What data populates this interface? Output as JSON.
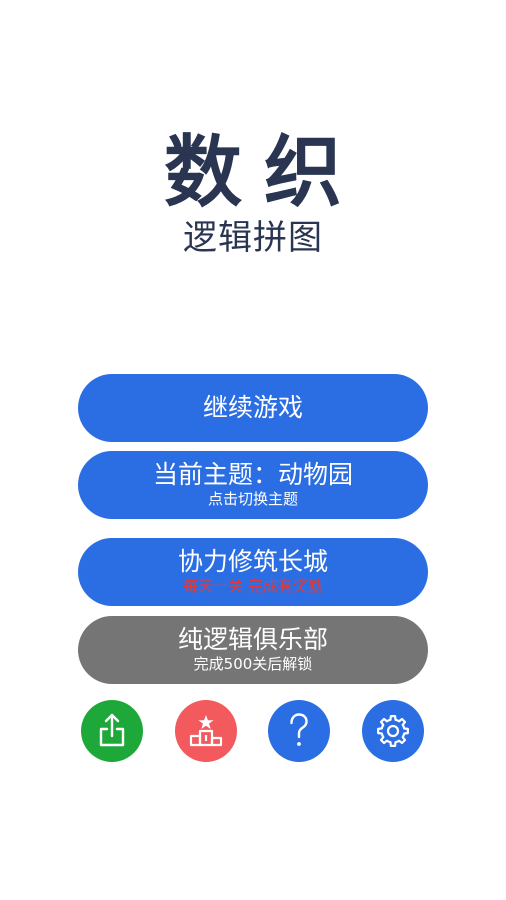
{
  "header": {
    "title": "数织",
    "subtitle": "逻辑拼图"
  },
  "menu": {
    "continue": {
      "label": "继续游戏"
    },
    "theme": {
      "label": "当前主题：动物园",
      "sub": "点击切换主题"
    },
    "great_wall": {
      "label": "协力修筑长城",
      "sub": "每天一关 完成有奖励"
    },
    "club": {
      "label": "纯逻辑俱乐部",
      "sub": "完成500关后解锁"
    }
  },
  "toolbar": {
    "share": {
      "icon": "share-icon",
      "color": "#1fa83a"
    },
    "leaderboard": {
      "icon": "podium-icon",
      "color": "#f25a5e"
    },
    "help": {
      "icon": "question-icon",
      "color": "#2b6ee3"
    },
    "settings": {
      "icon": "gear-icon",
      "color": "#2b6ee3"
    }
  },
  "colors": {
    "accent": "#2b6ee3",
    "locked": "#757575",
    "title": "#2a3552",
    "highlight": "#e23a3a"
  }
}
